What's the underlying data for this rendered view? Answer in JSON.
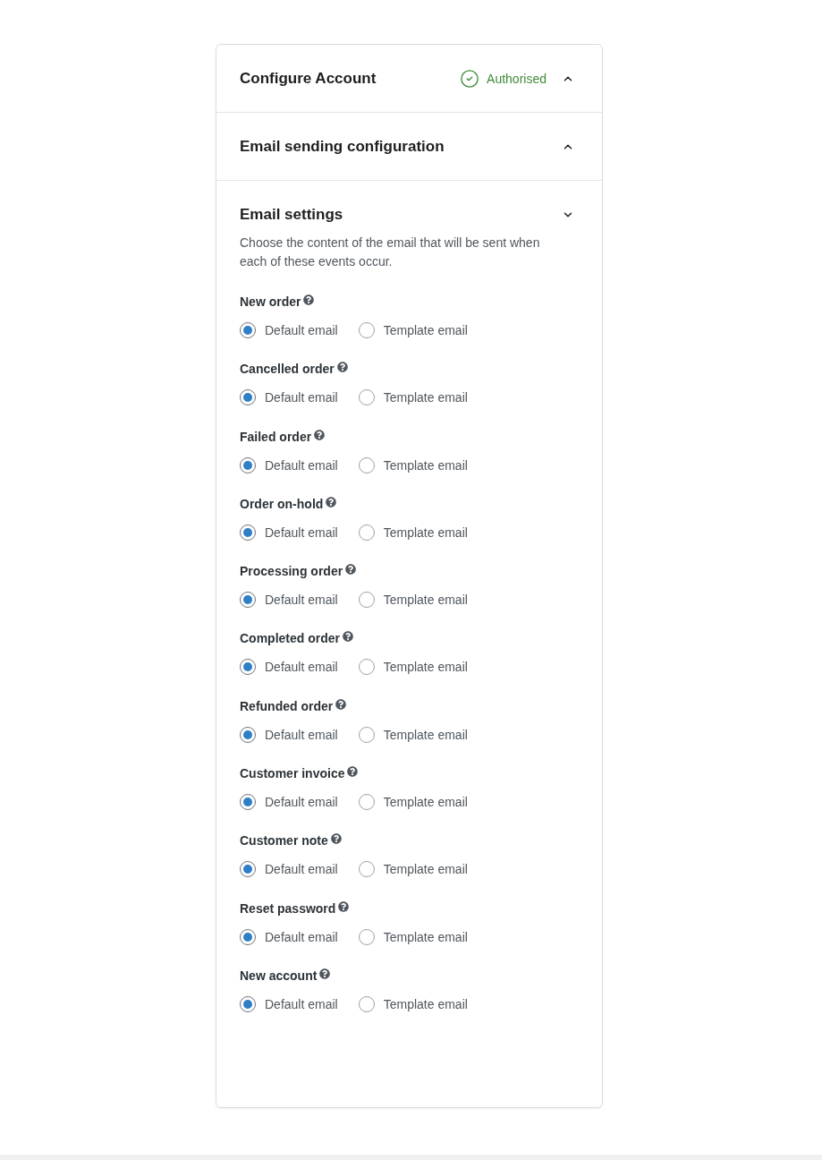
{
  "panels": [
    {
      "title": "Configure Account",
      "status": {
        "kind": "success",
        "label": "Authorised"
      },
      "expanded": false
    },
    {
      "title": "Email sending configuration",
      "expanded": false
    },
    {
      "title": "Email settings",
      "expanded": true,
      "description": "Choose the content of the email that will be sent when each of these events occur.",
      "events": [
        {
          "label": "New order",
          "options": [
            {
              "label": "Default email",
              "selected": true
            },
            {
              "label": "Template email",
              "selected": false
            }
          ]
        },
        {
          "label": "Cancelled order",
          "options": [
            {
              "label": "Default email",
              "selected": true
            },
            {
              "label": "Template email",
              "selected": false
            }
          ]
        },
        {
          "label": "Failed order",
          "options": [
            {
              "label": "Default email",
              "selected": true
            },
            {
              "label": "Template email",
              "selected": false
            }
          ]
        },
        {
          "label": "Order on-hold",
          "options": [
            {
              "label": "Default email",
              "selected": true
            },
            {
              "label": "Template email",
              "selected": false
            }
          ]
        },
        {
          "label": "Processing order",
          "options": [
            {
              "label": "Default email",
              "selected": true
            },
            {
              "label": "Template email",
              "selected": false
            }
          ]
        },
        {
          "label": "Completed order",
          "options": [
            {
              "label": "Default email",
              "selected": true
            },
            {
              "label": "Template email",
              "selected": false
            }
          ]
        },
        {
          "label": "Refunded order",
          "options": [
            {
              "label": "Default email",
              "selected": true
            },
            {
              "label": "Template email",
              "selected": false
            }
          ]
        },
        {
          "label": "Customer invoice",
          "options": [
            {
              "label": "Default email",
              "selected": true
            },
            {
              "label": "Template email",
              "selected": false
            }
          ]
        },
        {
          "label": "Customer note",
          "options": [
            {
              "label": "Default email",
              "selected": true
            },
            {
              "label": "Template email",
              "selected": false
            }
          ]
        },
        {
          "label": "Reset password",
          "options": [
            {
              "label": "Default email",
              "selected": true
            },
            {
              "label": "Template email",
              "selected": false
            }
          ]
        },
        {
          "label": "New account",
          "options": [
            {
              "label": "Default email",
              "selected": true
            },
            {
              "label": "Template email",
              "selected": false
            }
          ]
        }
      ]
    }
  ]
}
